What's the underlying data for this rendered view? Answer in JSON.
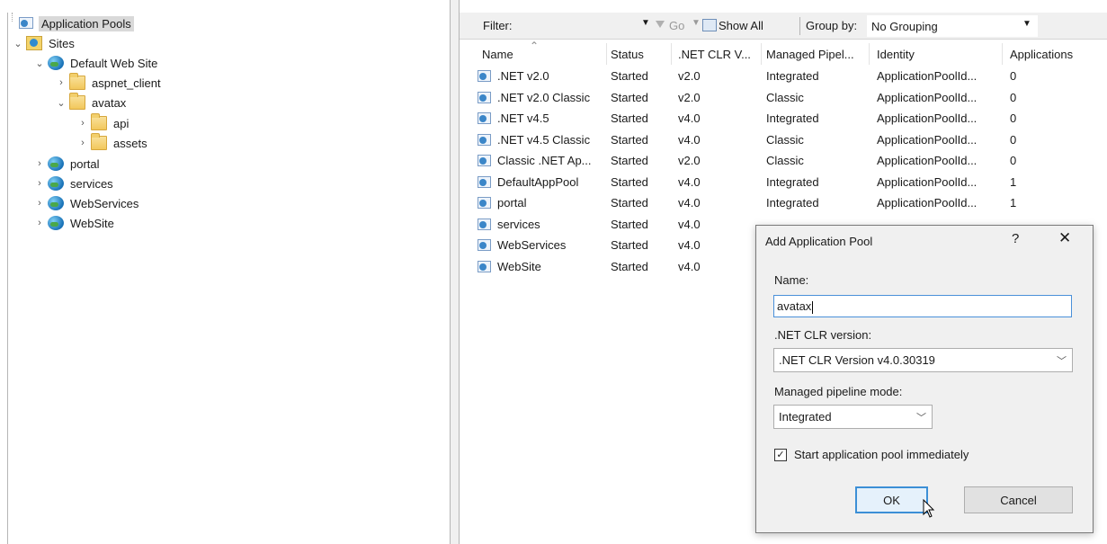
{
  "tree": {
    "items": [
      {
        "label": "Application Pools",
        "selected": true
      },
      {
        "label": "Sites"
      },
      {
        "label": "Default Web Site"
      },
      {
        "label": "aspnet_client"
      },
      {
        "label": "avatax"
      },
      {
        "label": "api"
      },
      {
        "label": "assets"
      },
      {
        "label": "portal"
      },
      {
        "label": "services"
      },
      {
        "label": "WebServices"
      },
      {
        "label": "WebSite"
      }
    ]
  },
  "toolbar": {
    "filter_label": "Filter:",
    "go_label": "Go",
    "show_all_label": "Show All",
    "group_by_label": "Group by:",
    "group_by_value": "No Grouping"
  },
  "grid": {
    "columns": [
      "Name",
      "Status",
      ".NET CLR V...",
      "Managed Pipel...",
      "Identity",
      "Applications"
    ],
    "rows": [
      {
        "name": ".NET v2.0",
        "status": "Started",
        "clr": "v2.0",
        "pipeline": "Integrated",
        "identity": "ApplicationPoolId...",
        "apps": "0"
      },
      {
        "name": ".NET v2.0 Classic",
        "status": "Started",
        "clr": "v2.0",
        "pipeline": "Classic",
        "identity": "ApplicationPoolId...",
        "apps": "0"
      },
      {
        "name": ".NET v4.5",
        "status": "Started",
        "clr": "v4.0",
        "pipeline": "Integrated",
        "identity": "ApplicationPoolId...",
        "apps": "0"
      },
      {
        "name": ".NET v4.5 Classic",
        "status": "Started",
        "clr": "v4.0",
        "pipeline": "Classic",
        "identity": "ApplicationPoolId...",
        "apps": "0"
      },
      {
        "name": "Classic .NET Ap...",
        "status": "Started",
        "clr": "v2.0",
        "pipeline": "Classic",
        "identity": "ApplicationPoolId...",
        "apps": "0"
      },
      {
        "name": "DefaultAppPool",
        "status": "Started",
        "clr": "v4.0",
        "pipeline": "Integrated",
        "identity": "ApplicationPoolId...",
        "apps": "1"
      },
      {
        "name": "portal",
        "status": "Started",
        "clr": "v4.0",
        "pipeline": "Integrated",
        "identity": "ApplicationPoolId...",
        "apps": "1"
      },
      {
        "name": "services",
        "status": "Started",
        "clr": "v4.0",
        "pipeline": "",
        "identity": "",
        "apps": ""
      },
      {
        "name": "WebServices",
        "status": "Started",
        "clr": "v4.0",
        "pipeline": "",
        "identity": "",
        "apps": ""
      },
      {
        "name": "WebSite",
        "status": "Started",
        "clr": "v4.0",
        "pipeline": "",
        "identity": "",
        "apps": ""
      }
    ]
  },
  "dialog": {
    "title": "Add Application Pool",
    "help": "?",
    "close": "✕",
    "name_label": "Name:",
    "name_value": "avatax",
    "clr_label": ".NET CLR version:",
    "clr_value": ".NET CLR Version v4.0.30319",
    "pipeline_label": "Managed pipeline mode:",
    "pipeline_value": "Integrated",
    "start_checked": true,
    "start_label": "Start application pool immediately",
    "ok_label": "OK",
    "cancel_label": "Cancel"
  }
}
